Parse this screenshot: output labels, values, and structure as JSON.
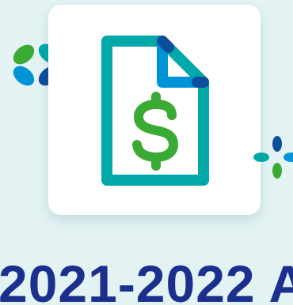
{
  "headline": {
    "text": "2021-2022 A"
  },
  "icons": {
    "main": "invoice-document-dollar-icon",
    "left_decoration": "sparkle-icon",
    "right_decoration": "sparkle-icon"
  },
  "colors": {
    "background": "#e3f3f4",
    "card": "#ffffff",
    "teal": "#00a8a8",
    "blue": "#0093d6",
    "navy": "#0d4e9c",
    "green": "#3aaa35",
    "headline": "#1b2f8c"
  }
}
